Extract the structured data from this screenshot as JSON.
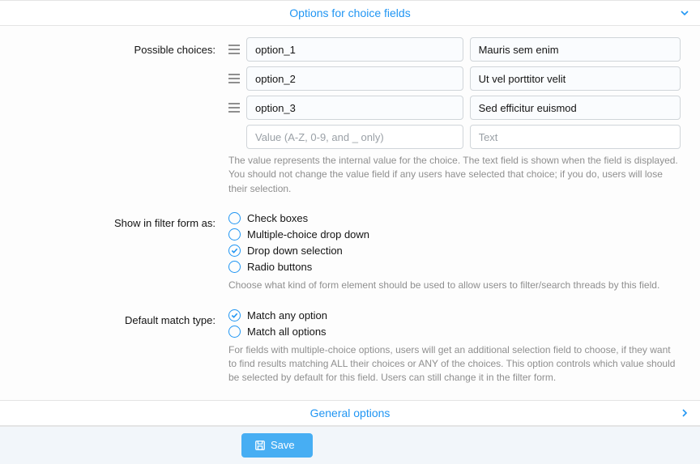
{
  "sections": {
    "choice": {
      "title": "Options for choice fields"
    },
    "general": {
      "title": "General options"
    }
  },
  "labels": {
    "possible": "Possible choices:",
    "filter": "Show in filter form as:",
    "match": "Default match type:"
  },
  "choices": {
    "rows": [
      {
        "value": "option_1",
        "text": "Mauris sem enim"
      },
      {
        "value": "option_2",
        "text": "Ut vel porttitor velit"
      },
      {
        "value": "option_3",
        "text": "Sed efficitur euismod"
      }
    ],
    "placeholder_value": "Value (A-Z, 0-9, and _ only)",
    "placeholder_text": "Text",
    "help": "The value represents the internal value for the choice. The text field is shown when the field is displayed. You should not change the value field if any users have selected that choice; if you do, users will lose their selection."
  },
  "filter": {
    "options": [
      {
        "label": "Check boxes",
        "checked": false
      },
      {
        "label": "Multiple-choice drop down",
        "checked": false
      },
      {
        "label": "Drop down selection",
        "checked": true
      },
      {
        "label": "Radio buttons",
        "checked": false
      }
    ],
    "help": "Choose what kind of form element should be used to allow users to filter/search threads by this field."
  },
  "match": {
    "options": [
      {
        "label": "Match any option",
        "checked": true
      },
      {
        "label": "Match all options",
        "checked": false
      }
    ],
    "help": "For fields with multiple-choice options, users will get an additional selection field to choose, if they want to find results matching ALL their choices or ANY of the choices. This option controls which value should be selected by default for this field. Users can still change it in the filter form."
  },
  "footer": {
    "save": "Save"
  }
}
